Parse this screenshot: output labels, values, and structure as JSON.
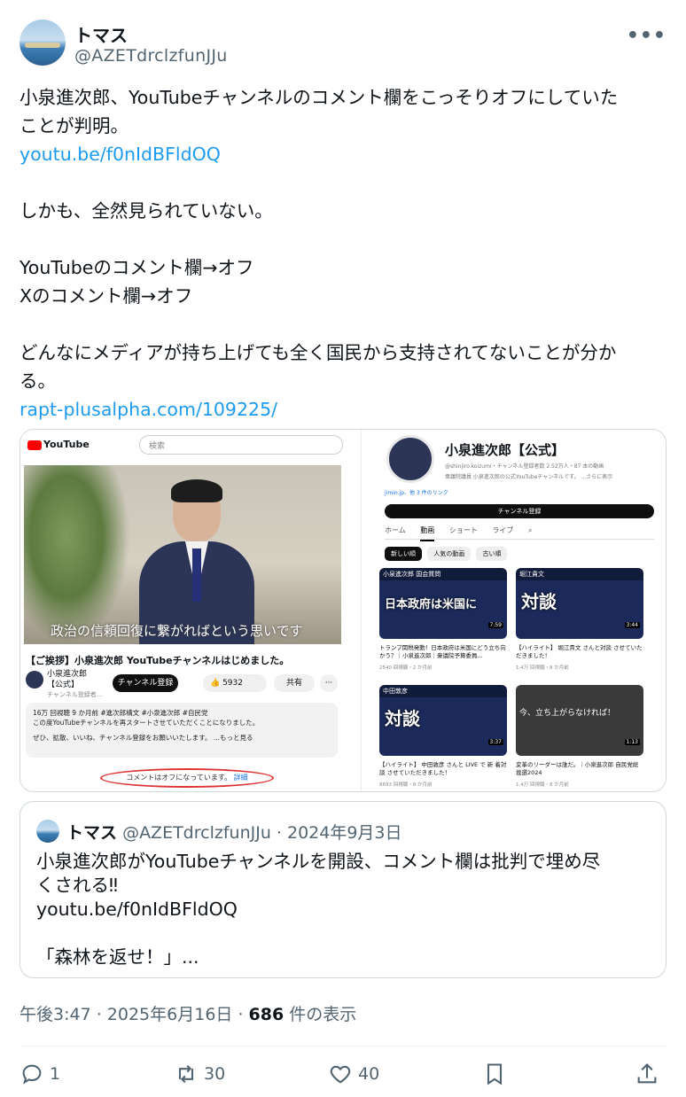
{
  "author": {
    "display_name": "トマス",
    "handle": "@AZETdrclzfunJJu"
  },
  "tweet": {
    "lines": [
      "小泉進次郎、YouTubeチャンネルのコメント欄をこっそりオフにしていた",
      "ことが判明。"
    ],
    "link1": "youtu.be/f0nIdBFldOQ",
    "line_a": "しかも、全然見られていない。",
    "line_b": "YouTubeのコメント欄→オフ",
    "line_c": "Xのコメント欄→オフ",
    "line_d1": "どんなにメディアが持ち上げても全く国民から支持されてないことが分か",
    "line_d2": "る。",
    "link2": "rapt-plusalpha.com/109225/"
  },
  "media": {
    "left": {
      "logo": "YouTube",
      "search_placeholder": "検索",
      "subtitle": "政治の信頼回復に繋がればという思いです",
      "video_title": "【ご挨拶】小泉進次郎 YouTubeチャンネルはじめました。",
      "channel_name": "小泉進次郎【公式】",
      "channel_sub": "チャンネル登録者...",
      "subscribe": "チャンネル登録",
      "likes": "5932",
      "share": "共有",
      "desc1": "16万 回視聴  9 か月前  #進次郎構文 #小泉進次郎 #自民党",
      "desc2": "この度YouTubeチャンネルを再スタートさせていただくことになりました。",
      "desc3": "ぜひ、拡散、いいね、チャンネル登録をお願いいたします。 ...もっと見る",
      "comment_off": "コメントはオフになっています。",
      "comment_detail": "詳細"
    },
    "right": {
      "channel_name": "小泉進次郎【公式】",
      "handle": "@shinjiro.koizumi・チャンネル登録者数 2.52万人・87 本の動画",
      "desc": "衆議院議員 小泉進次郎の公式YouTubeチャンネルです。 ...さらに表示",
      "link": "jimin.jp、他 3 件のリンク",
      "subscribe": "チャンネル登録",
      "tabs": [
        "ホーム",
        "動画",
        "ショート",
        "ライブ"
      ],
      "chips": [
        "新しい順",
        "人気の動画",
        "古い順"
      ],
      "videos": [
        {
          "thumb_top": "小泉進次郎 国会質問",
          "thumb_big": "日本政府は米国に",
          "dur": "7:59",
          "title": "トランプ関税発動！日本政府は米国にどう立ち向かう？｜小泉進次郎｜衆議院予算委員...",
          "meta": "2540 回視聴・2 か月前"
        },
        {
          "thumb_top": "堀江貴文",
          "thumb_big": "対談",
          "dur": "3:44",
          "title": "【ハイライト】 堀江貴文 さんと対談 させていただきました！",
          "meta": "1.4万 回視聴・8 か月前"
        },
        {
          "thumb_top": "中田敦彦",
          "thumb_big": "対談",
          "dur": "3:37",
          "title": "【ハイライト】 中田敦彦 さんと LIVE で 新 着対談 させていただきました！",
          "meta": "8693 回視聴・8 か月前"
        },
        {
          "thumb_top": "今、立ち上がらなければ！",
          "thumb_big": "",
          "dur": "1:13",
          "title": "変革のリーダーは誰だ。｜小泉進次郎 自民党総裁選2024",
          "meta": "1.4万 回視聴・8 か月前"
        }
      ]
    }
  },
  "quote": {
    "name": "トマス",
    "handle_date": "@AZETdrclzfunJJu · 2024年9月3日",
    "line1": "小泉進次郎がYouTubeチャンネルを開設、コメント欄は批判で埋め尽",
    "line2": "くされる‼︎",
    "line3": "youtu.be/f0nIdBFldOQ",
    "line4": "「森林を返せ！」..."
  },
  "meta": {
    "time": "午後3:47 · 2025年6月16日 · ",
    "views": "686",
    "views_label": " 件の表示"
  },
  "actions": {
    "replies": "1",
    "reposts": "30",
    "likes": "40"
  },
  "colors": {
    "link": "#1d9bf0",
    "secondary": "#536471",
    "border": "#cfd9de"
  }
}
